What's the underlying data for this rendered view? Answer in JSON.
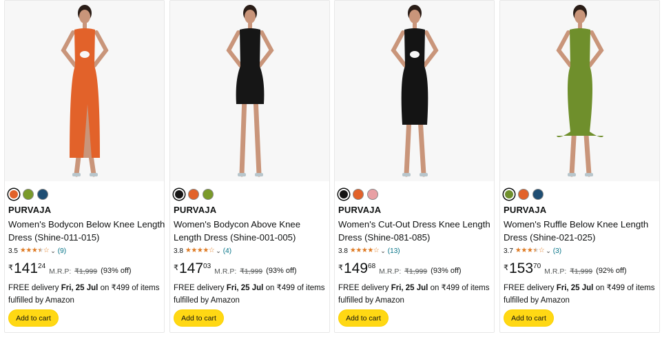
{
  "products": [
    {
      "brand": "PURVAJA",
      "title": "Women's Bodycon Below Knee Length Dress (Shine-011-015)",
      "rating": "3.5",
      "stars": 3.5,
      "review_count": "(9)",
      "currency": "₹",
      "price_whole": "141",
      "price_fraction": "24",
      "mrp_label": "M.R.P:",
      "mrp": "₹1,999",
      "discount": "(93% off)",
      "delivery_prefix": "FREE delivery ",
      "delivery_date": "Fri, 25 Jul",
      "delivery_suffix": " on ₹499 of items fulfilled by Amazon",
      "button": "Add to cart",
      "dress_color": "#e2622a",
      "dress_style": "long-slit",
      "swatches": [
        "#e2622a",
        "#7a9a2a",
        "#1f4e73"
      ],
      "selected_swatch": 0
    },
    {
      "brand": "PURVAJA",
      "title": "Women's Bodycon Above Knee Length Dress (Shine-001-005)",
      "rating": "3.8",
      "stars": 4,
      "review_count": "(4)",
      "currency": "₹",
      "price_whole": "147",
      "price_fraction": "03",
      "mrp_label": "M.R.P:",
      "mrp": "₹1,999",
      "discount": "(93% off)",
      "delivery_prefix": "FREE delivery ",
      "delivery_date": "Fri, 25 Jul",
      "delivery_suffix": " on ₹499 of items fulfilled by Amazon",
      "button": "Add to cart",
      "dress_color": "#161616",
      "dress_style": "short",
      "swatches": [
        "#161616",
        "#e2622a",
        "#7a9a2a"
      ],
      "selected_swatch": 0
    },
    {
      "brand": "PURVAJA",
      "title": "Women's Cut-Out Dress Knee Length Dress (Shine-081-085)",
      "rating": "3.8",
      "stars": 4,
      "review_count": "(13)",
      "currency": "₹",
      "price_whole": "149",
      "price_fraction": "68",
      "mrp_label": "M.R.P:",
      "mrp": "₹1,999",
      "discount": "(93% off)",
      "delivery_prefix": "FREE delivery ",
      "delivery_date": "Fri, 25 Jul",
      "delivery_suffix": " on ₹499 of items fulfilled by Amazon",
      "button": "Add to cart",
      "dress_color": "#141414",
      "dress_style": "knee",
      "swatches": [
        "#141414",
        "#e2622a",
        "#e8a0a4"
      ],
      "selected_swatch": 0
    },
    {
      "brand": "PURVAJA",
      "title": "Women's Ruffle Below Knee Length Dress (Shine-021-025)",
      "rating": "3.7",
      "stars": 3.5,
      "review_count": "(3)",
      "currency": "₹",
      "price_whole": "153",
      "price_fraction": "70",
      "mrp_label": "M.R.P:",
      "mrp": "₹1,999",
      "discount": "(92% off)",
      "delivery_prefix": "FREE delivery ",
      "delivery_date": "Fri, 25 Jul",
      "delivery_suffix": " on ₹499 of items fulfilled by Amazon",
      "button": "Add to cart",
      "dress_color": "#6f8f2c",
      "dress_style": "ruffle",
      "swatches": [
        "#6f8f2c",
        "#e2622a",
        "#1f4e73"
      ],
      "selected_swatch": 0
    }
  ]
}
